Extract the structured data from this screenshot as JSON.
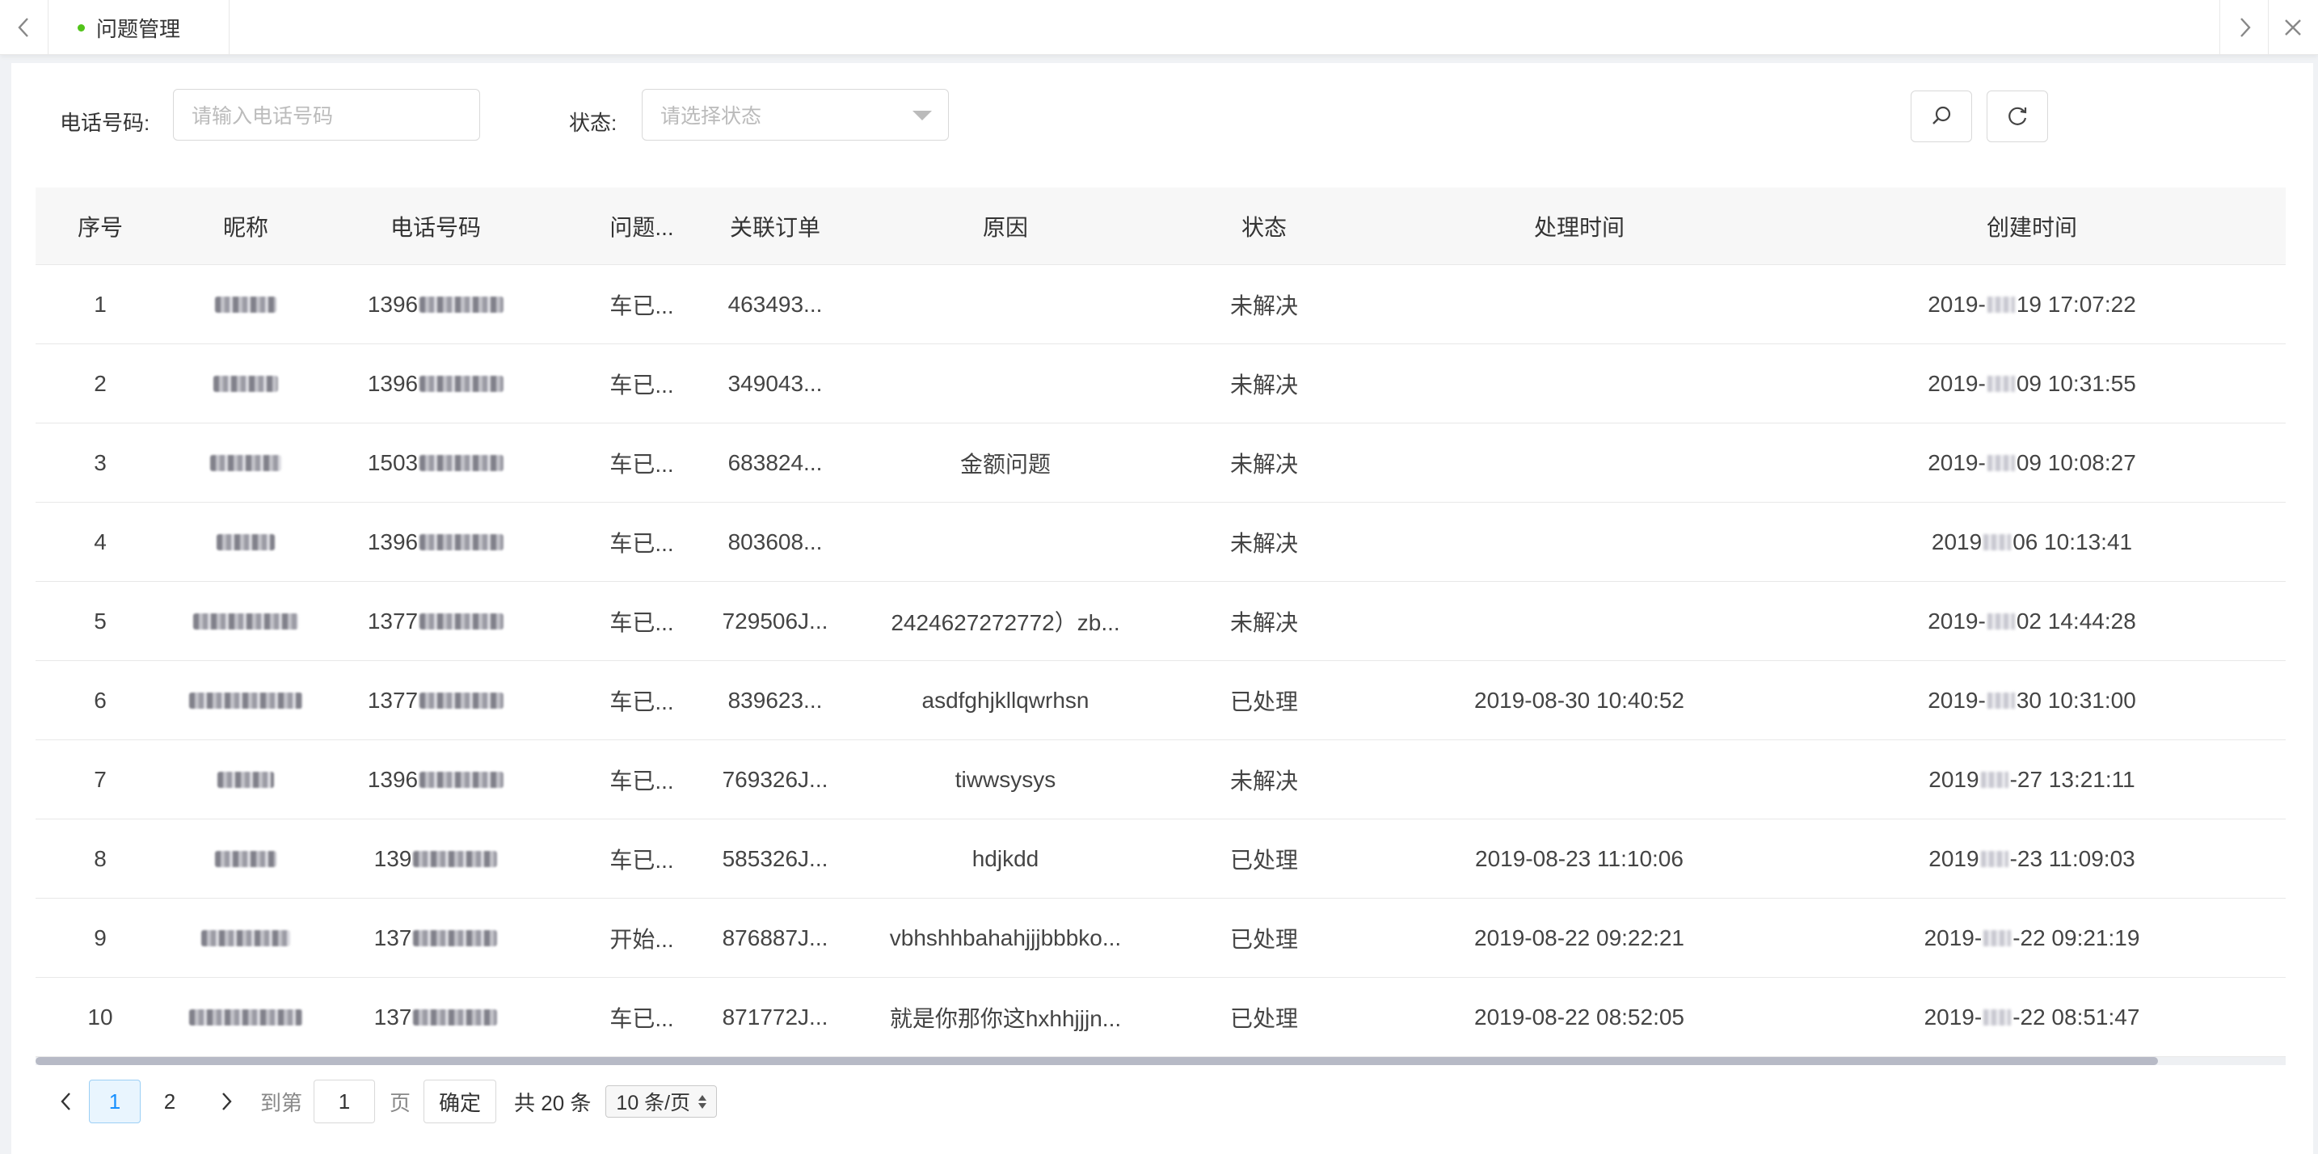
{
  "tabs": {
    "active_label": "问题管理"
  },
  "filters": {
    "phone_label": "电话号码:",
    "phone_placeholder": "请输入电话号码",
    "status_label": "状态:",
    "status_placeholder": "请选择状态"
  },
  "table": {
    "headers": [
      "序号",
      "昵称",
      "电话号码",
      "问题...",
      "关联订单",
      "原因",
      "状态",
      "处理时间",
      "创建时间"
    ],
    "rows": [
      {
        "no": "1",
        "issue": "车已...",
        "order": "463493...",
        "reason": "",
        "status": "未解决",
        "handled": "",
        "created_a": "2019-",
        "created_b": "19 17:07:22"
      },
      {
        "no": "2",
        "issue": "车已...",
        "order": "349043...",
        "reason": "",
        "status": "未解决",
        "handled": "",
        "created_a": "2019-",
        "created_b": "09 10:31:55"
      },
      {
        "no": "3",
        "issue": "车已...",
        "order": "683824...",
        "reason": "金额问题",
        "status": "未解决",
        "handled": "",
        "created_a": "2019-",
        "created_b": "09 10:08:27"
      },
      {
        "no": "4",
        "issue": "车已...",
        "order": "803608...",
        "reason": "",
        "status": "未解决",
        "handled": "",
        "created_a": "2019",
        "created_b": "06 10:13:41"
      },
      {
        "no": "5",
        "issue": "车已...",
        "order": "729506J...",
        "reason": "2424627272772）zb...",
        "status": "未解决",
        "handled": "",
        "created_a": "2019-",
        "created_b": "02 14:44:28"
      },
      {
        "no": "6",
        "issue": "车已...",
        "order": "839623...",
        "reason": "asdfghjkllqwrhsn",
        "status": "已处理",
        "handled": "2019-08-30 10:40:52",
        "created_a": "2019-",
        "created_b": "30 10:31:00"
      },
      {
        "no": "7",
        "issue": "车已...",
        "order": "769326J...",
        "reason": "tiwwsysys",
        "status": "未解决",
        "handled": "",
        "created_a": "2019",
        "created_b": "-27 13:21:11"
      },
      {
        "no": "8",
        "issue": "车已...",
        "order": "585326J...",
        "reason": "hdjkdd",
        "status": "已处理",
        "handled": "2019-08-23 11:10:06",
        "created_a": "2019",
        "created_b": "-23 11:09:03"
      },
      {
        "no": "9",
        "issue": "开始...",
        "order": "876887J...",
        "reason": "vbhshhbahahjjjbbbko...",
        "status": "已处理",
        "handled": "2019-08-22 09:22:21",
        "created_a": "2019-",
        "created_b": "-22 09:21:19"
      },
      {
        "no": "10",
        "issue": "车已...",
        "order": "871772J...",
        "reason": "就是你那你这hxhhjjjn...",
        "status": "已处理",
        "handled": "2019-08-22 08:52:05",
        "created_a": "2019-",
        "created_b": "-22 08:51:47"
      }
    ]
  },
  "pagination": {
    "pages": [
      "1",
      "2"
    ],
    "goto_label": "到第",
    "goto_value": "1",
    "page_unit": "页",
    "confirm_label": "确定",
    "total_label": "共 20 条",
    "page_size": "10 条/页"
  },
  "colors": {
    "accent": "#1890ff",
    "tab_dot": "#52c41a"
  },
  "icons": [
    "chevron-left-icon",
    "chevron-right-icon",
    "close-icon",
    "search-icon",
    "refresh-icon",
    "chevron-down-icon"
  ]
}
